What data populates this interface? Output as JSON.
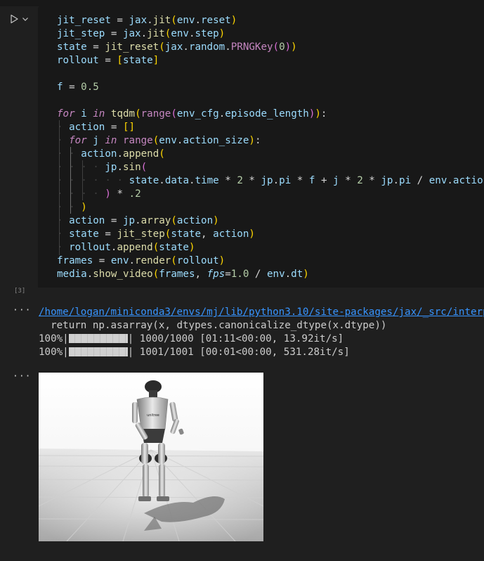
{
  "cell": {
    "execution_count": "[3]",
    "run_icon": "play-icon",
    "menu_icon": "chevron-down-icon",
    "code": {
      "jit_reset": "jit_reset",
      "jit_step": "jit_step",
      "jax": "jax",
      "jit": "jit",
      "env": "env",
      "reset": "reset",
      "step": "step",
      "state": "state",
      "random": "random",
      "PRNGKey": "PRNGKey",
      "zero": "0",
      "rollout": "rollout",
      "f": "f",
      "half": "0.5",
      "for": "for",
      "in": "in",
      "i": "i",
      "j": "j",
      "tqdm": "tqdm",
      "range": "range",
      "env_cfg": "env_cfg",
      "episode_length": "episode_length",
      "action": "action",
      "action_size": "action_size",
      "append": "append",
      "jp": "jp",
      "sin": "sin",
      "data": "data",
      "time": "time",
      "two": "2",
      "pi": "pi",
      "action_trunc": "action_",
      "point2": ".2",
      "array": "array",
      "frames": "frames",
      "render": "render",
      "media": "media",
      "show_video": "show_video",
      "fps": "fps",
      "one": "1.0",
      "dt": "dt"
    }
  },
  "output": {
    "ellipsis": "···",
    "warning_path": "/home/logan/miniconda3/envs/mj/lib/python3.10/site-packages/jax/_src/interp",
    "warning_code": "  return np.asarray(x, dtypes.canonicalize_dtype(x.dtype))",
    "progress": [
      {
        "pct": "100%|",
        "value": 1.0,
        "stats": "| 1000/1000 [01:11<00:00, 13.92it/s]"
      },
      {
        "pct": "100%|",
        "value": 1.0,
        "stats": "| 1001/1001 [00:01<00:00, 531.28it/s]"
      }
    ],
    "robot_logo_text": "unitree"
  },
  "colors": {
    "background": "#1f1f1f",
    "editor": "#181818",
    "link": "#3794ff",
    "keyword": "#c586c0",
    "variable": "#9cdcfe",
    "function": "#dcdcaa",
    "number": "#b5cea8"
  }
}
